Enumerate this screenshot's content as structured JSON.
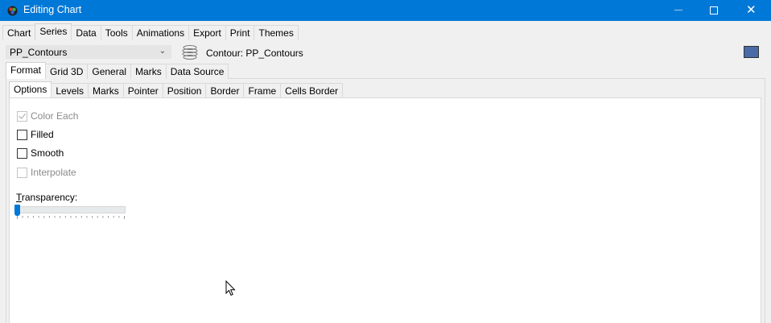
{
  "window": {
    "title": "Editing Chart",
    "minimize_glyph": "—",
    "maximize_glyph": "☐",
    "close_glyph": "✕"
  },
  "top_tabs": [
    "Chart",
    "Series",
    "Data",
    "Tools",
    "Animations",
    "Export",
    "Print",
    "Themes"
  ],
  "top_tabs_active": "Series",
  "series_selector": {
    "value": "PP_Contours",
    "icon": "contour-series-icon",
    "label": "Contour: PP_Contours",
    "color": "#4a6aa8"
  },
  "series_tabs": [
    "Format",
    "Grid 3D",
    "General",
    "Marks",
    "Data Source"
  ],
  "series_tabs_active": "Format",
  "format_tabs": [
    "Options",
    "Levels",
    "Marks",
    "Pointer",
    "Position",
    "Border",
    "Frame",
    "Cells Border"
  ],
  "format_tabs_active": "Options",
  "options": {
    "color_each": {
      "label": "Color Each",
      "checked": true,
      "enabled": false
    },
    "filled": {
      "label": "Filled",
      "checked": false,
      "enabled": true
    },
    "smooth": {
      "label": "Smooth",
      "checked": false,
      "enabled": true
    },
    "interpolate": {
      "label": "Interpolate",
      "checked": false,
      "enabled": false
    },
    "transparency": {
      "label_first": "T",
      "label_rest": "ransparency:",
      "value": 0
    }
  },
  "colors": {
    "titlebar": "#0078d7",
    "slider_thumb": "#0078d7"
  }
}
